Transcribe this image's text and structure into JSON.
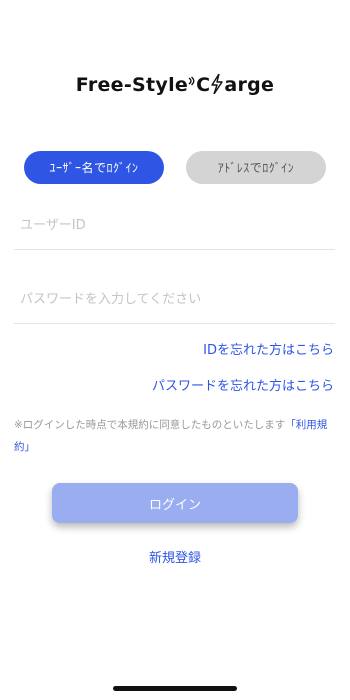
{
  "logo": {
    "part1": "Free-Style",
    "part2": "C",
    "part3": "arge"
  },
  "tabs": {
    "user_login": "ﾕｰｻﾞｰ名でﾛｸﾞｲﾝ",
    "mail_login": "ｱﾄﾞﾚｽでﾛｸﾞｲﾝ"
  },
  "form": {
    "user_placeholder": "ユーザーID",
    "password_placeholder": "パスワードを入力してください"
  },
  "links": {
    "forgot_id": "IDを忘れた方はこちら",
    "forgot_password": "パスワードを忘れた方はこちら"
  },
  "note": {
    "text": "※ログインした時点で本規約に同意したものといたします",
    "terms": "「利用規約」"
  },
  "buttons": {
    "login": "ログイン",
    "register": "新規登録"
  },
  "colors": {
    "accent": "#2f55e4",
    "login_disabled": "#9aadf0",
    "inactive_tab": "#d4d4d4"
  }
}
